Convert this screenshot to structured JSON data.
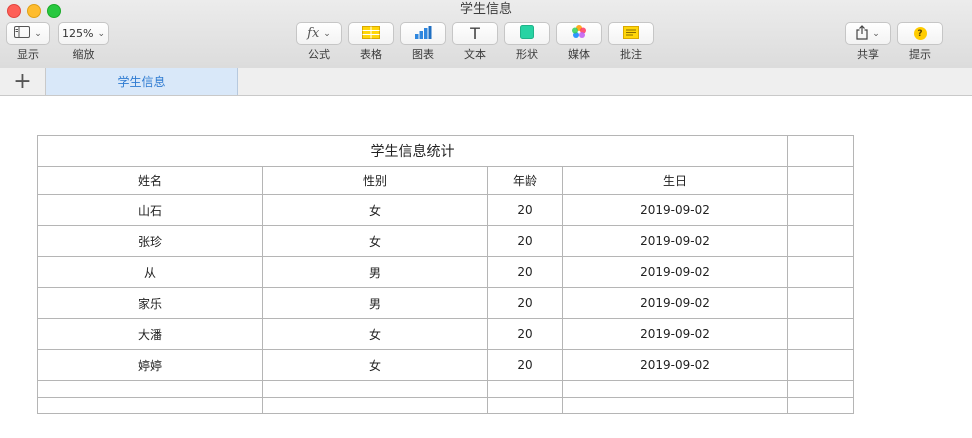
{
  "window": {
    "title": "学生信息"
  },
  "toolbar": {
    "view": {
      "label": "显示",
      "icon": "sidebar-icon"
    },
    "zoom": {
      "label": "缩放",
      "value": "125%"
    },
    "formula": {
      "label": "公式",
      "icon": "fx-icon",
      "glyph": "fx"
    },
    "table": {
      "label": "表格",
      "icon": "table-icon"
    },
    "chart": {
      "label": "图表",
      "icon": "bar-chart-icon"
    },
    "text": {
      "label": "文本",
      "icon": "text-icon",
      "glyph": "T"
    },
    "shape": {
      "label": "形状",
      "icon": "shape-icon"
    },
    "media": {
      "label": "媒体",
      "icon": "photos-icon"
    },
    "comment": {
      "label": "批注",
      "icon": "comment-icon"
    },
    "share": {
      "label": "共享",
      "icon": "share-icon"
    },
    "tips": {
      "label": "提示",
      "icon": "help-icon",
      "glyph": "?"
    }
  },
  "tabbar": {
    "add_label": "+",
    "sheet_tab": "学生信息"
  },
  "table": {
    "title": "学生信息统计",
    "headers": [
      "姓名",
      "性别",
      "年龄",
      "生日"
    ],
    "rows": [
      [
        "山石",
        "女",
        "20",
        "2019-09-02"
      ],
      [
        "张珍",
        "女",
        "20",
        "2019-09-02"
      ],
      [
        "从",
        "男",
        "20",
        "2019-09-02"
      ],
      [
        "家乐",
        "男",
        "20",
        "2019-09-02"
      ],
      [
        "大潘",
        "女",
        "20",
        "2019-09-02"
      ],
      [
        "婷婷",
        "女",
        "20",
        "2019-09-02"
      ]
    ]
  },
  "colors": {
    "accent": "#2f7bd1",
    "selected_tab_bg": "#d9e8f9",
    "grid_line": "#b5b5b5"
  }
}
